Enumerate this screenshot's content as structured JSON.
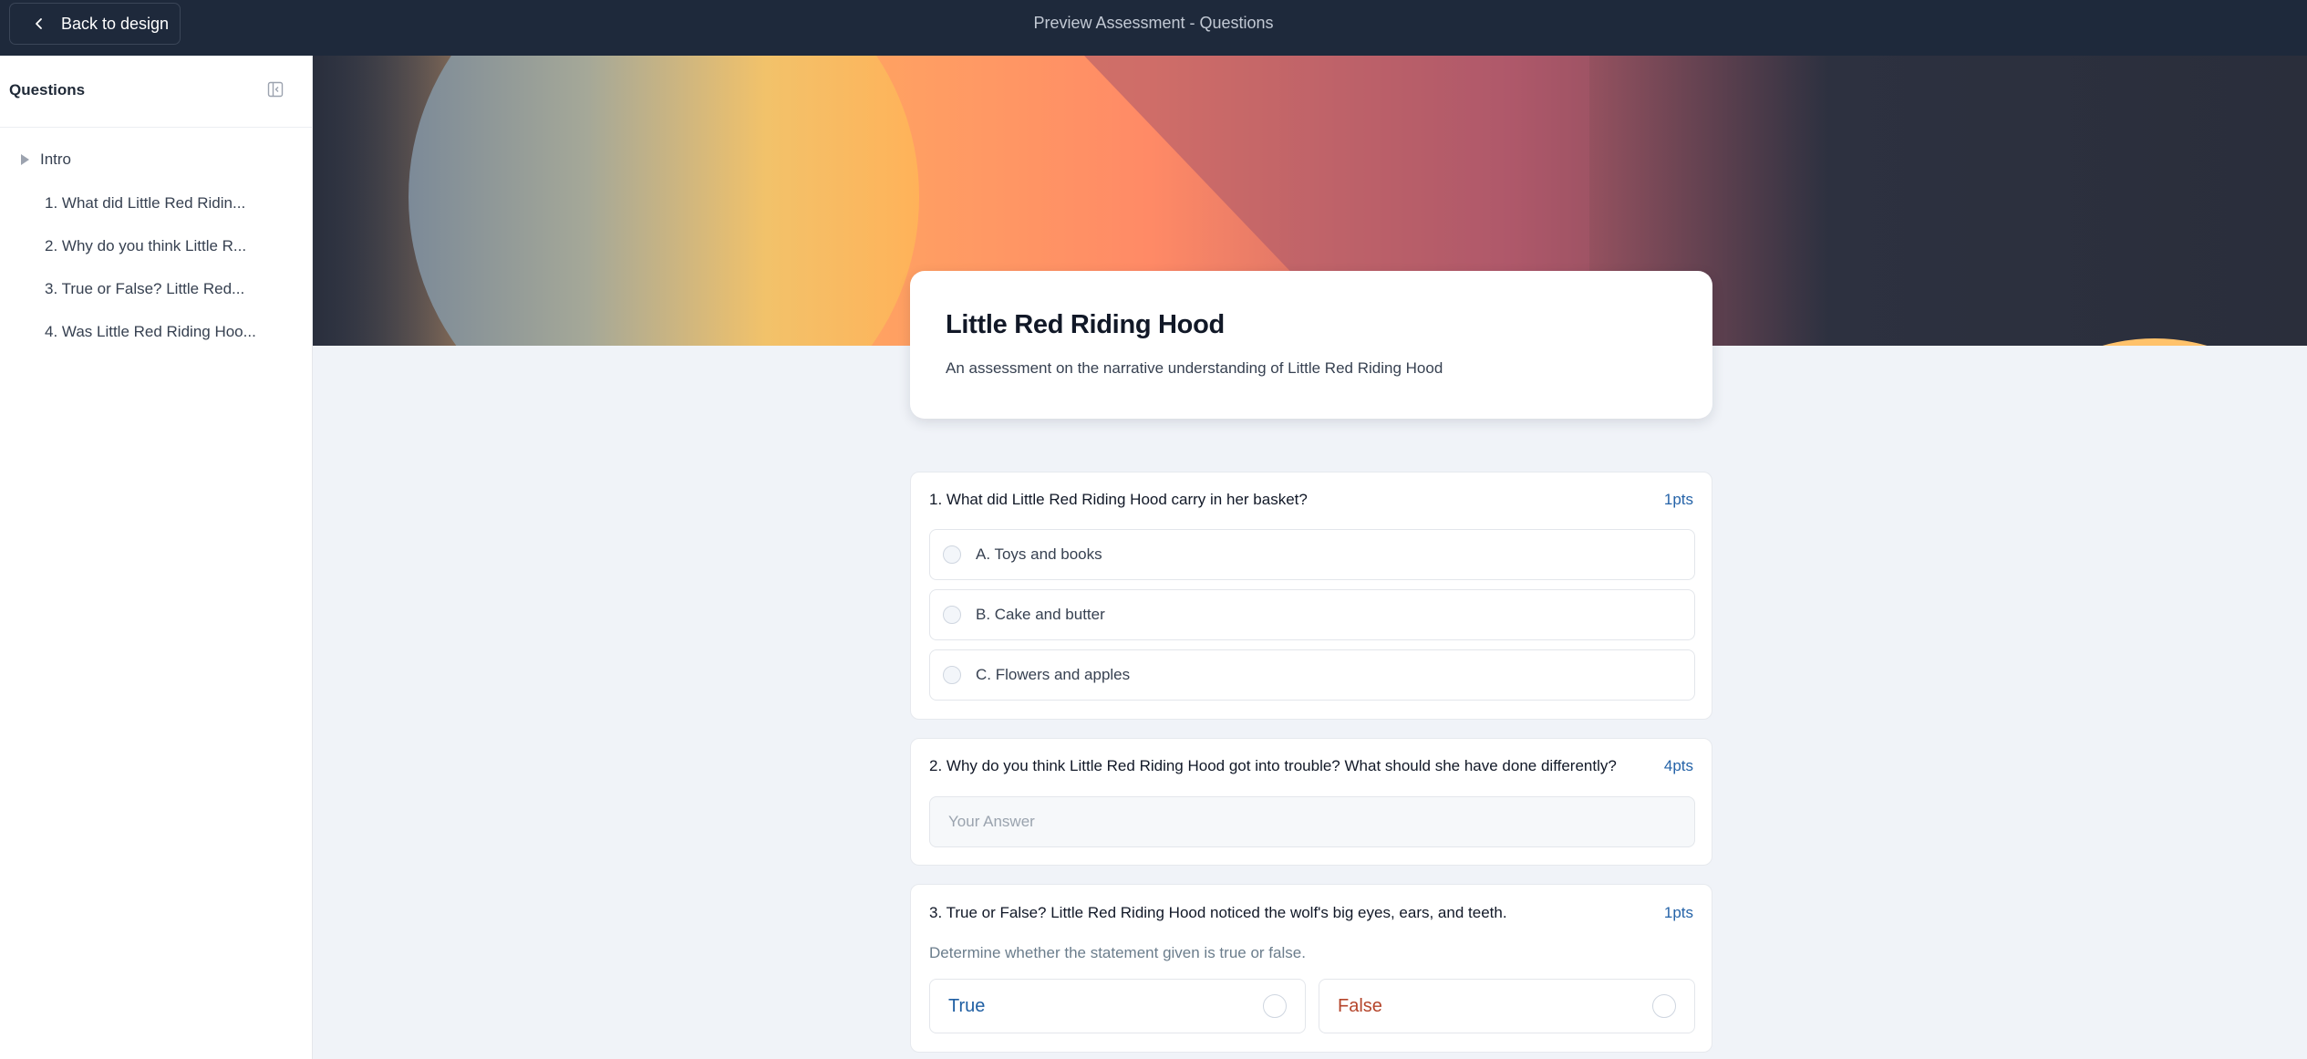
{
  "topbar": {
    "back_label": "Back to design",
    "title": "Preview Assessment - Questions"
  },
  "sidebar": {
    "title": "Questions",
    "intro_label": "Intro",
    "items": [
      {
        "label": "1. What did Little Red Ridin..."
      },
      {
        "label": "2. Why do you think Little R..."
      },
      {
        "label": "3. True or False? Little Red..."
      },
      {
        "label": "4. Was Little Red Riding Hoo..."
      }
    ]
  },
  "assessment": {
    "title": "Little Red Riding Hood",
    "description": "An assessment on the narrative understanding of Little Red Riding Hood"
  },
  "questions": [
    {
      "text": "1. What did Little Red Riding Hood carry in her basket?",
      "points": "1pts",
      "options": [
        "A. Toys and books",
        "B. Cake and butter",
        "C. Flowers and apples"
      ]
    },
    {
      "text": "2. Why do you think Little Red Riding Hood got into trouble? What should she have done differently?",
      "points": "4pts",
      "placeholder": "Your Answer"
    },
    {
      "text": "3. True or False? Little Red Riding Hood noticed the wolf's big eyes, ears, and teeth.",
      "points": "1pts",
      "description": "Determine whether the statement given is true or false.",
      "true_label": "True",
      "false_label": "False"
    }
  ],
  "colors": {
    "topbar_bg": "#1e293b",
    "accent_blue": "#2563a8",
    "true_color": "#1f5fa3",
    "false_color": "#b5452b"
  },
  "icons": {
    "back": "chevron-left-icon",
    "collapse": "sidebar-collapse-icon",
    "intro": "caret-right-icon"
  }
}
